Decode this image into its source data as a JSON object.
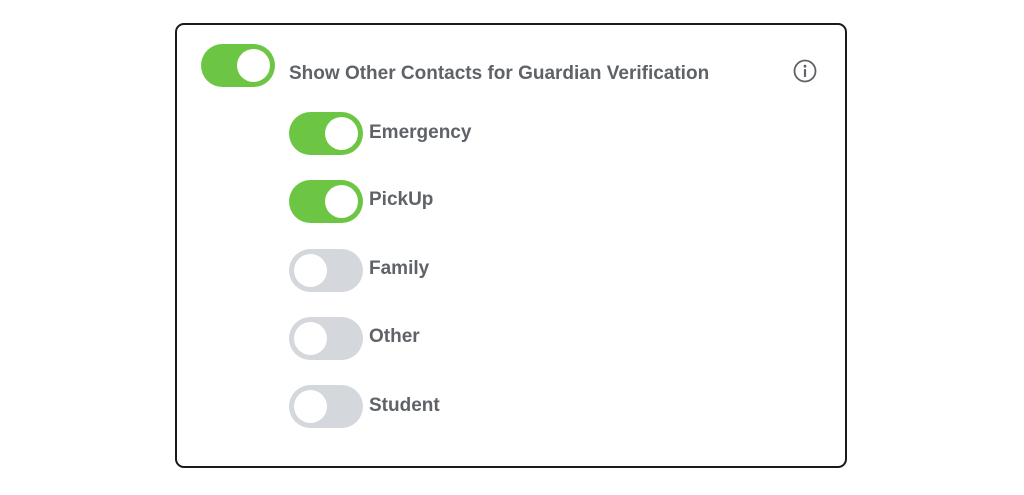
{
  "main_toggle": {
    "label": "Show Other Contacts for Guardian Verification",
    "enabled": true,
    "info_icon": "info-icon"
  },
  "contact_types": [
    {
      "label": "Emergency",
      "enabled": true
    },
    {
      "label": "PickUp",
      "enabled": true
    },
    {
      "label": "Family",
      "enabled": false
    },
    {
      "label": "Other",
      "enabled": false
    },
    {
      "label": "Student",
      "enabled": false
    }
  ],
  "colors": {
    "toggle_on": "#6cc644",
    "toggle_off": "#d4d7db",
    "label_text": "#5f6368",
    "border": "#1a1a1a"
  }
}
